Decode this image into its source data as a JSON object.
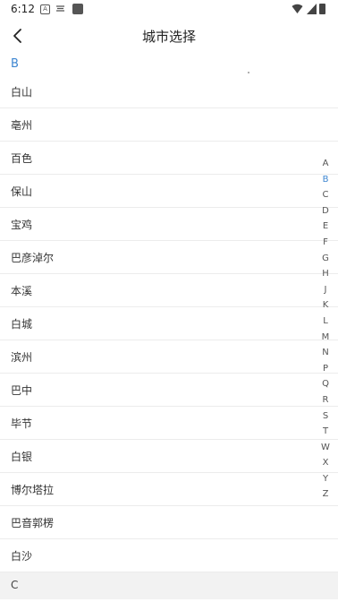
{
  "status_bar": {
    "time": "6:12",
    "icons": [
      "notification-a-icon",
      "notification-b-icon",
      "notification-c-icon",
      "wifi-icon",
      "signal-icon",
      "battery-icon"
    ]
  },
  "header": {
    "title": "城市选择",
    "back_icon": "chevron-left-icon"
  },
  "section_b": {
    "letter": "B"
  },
  "cities": [
    "白山",
    "亳州",
    "百色",
    "保山",
    "宝鸡",
    "巴彦淖尔",
    "本溪",
    "白城",
    "滨州",
    "巴中",
    "毕节",
    "白银",
    "博尔塔拉",
    "巴音郭楞",
    "白沙"
  ],
  "section_c": {
    "letter": "C"
  },
  "index_bar": {
    "letters": [
      "A",
      "B",
      "C",
      "D",
      "E",
      "F",
      "G",
      "H",
      "J",
      "K",
      "L",
      "M",
      "N",
      "P",
      "Q",
      "R",
      "S",
      "T",
      "W",
      "X",
      "Y",
      "Z"
    ],
    "active": "B",
    "active_color": "#3d86d1"
  }
}
